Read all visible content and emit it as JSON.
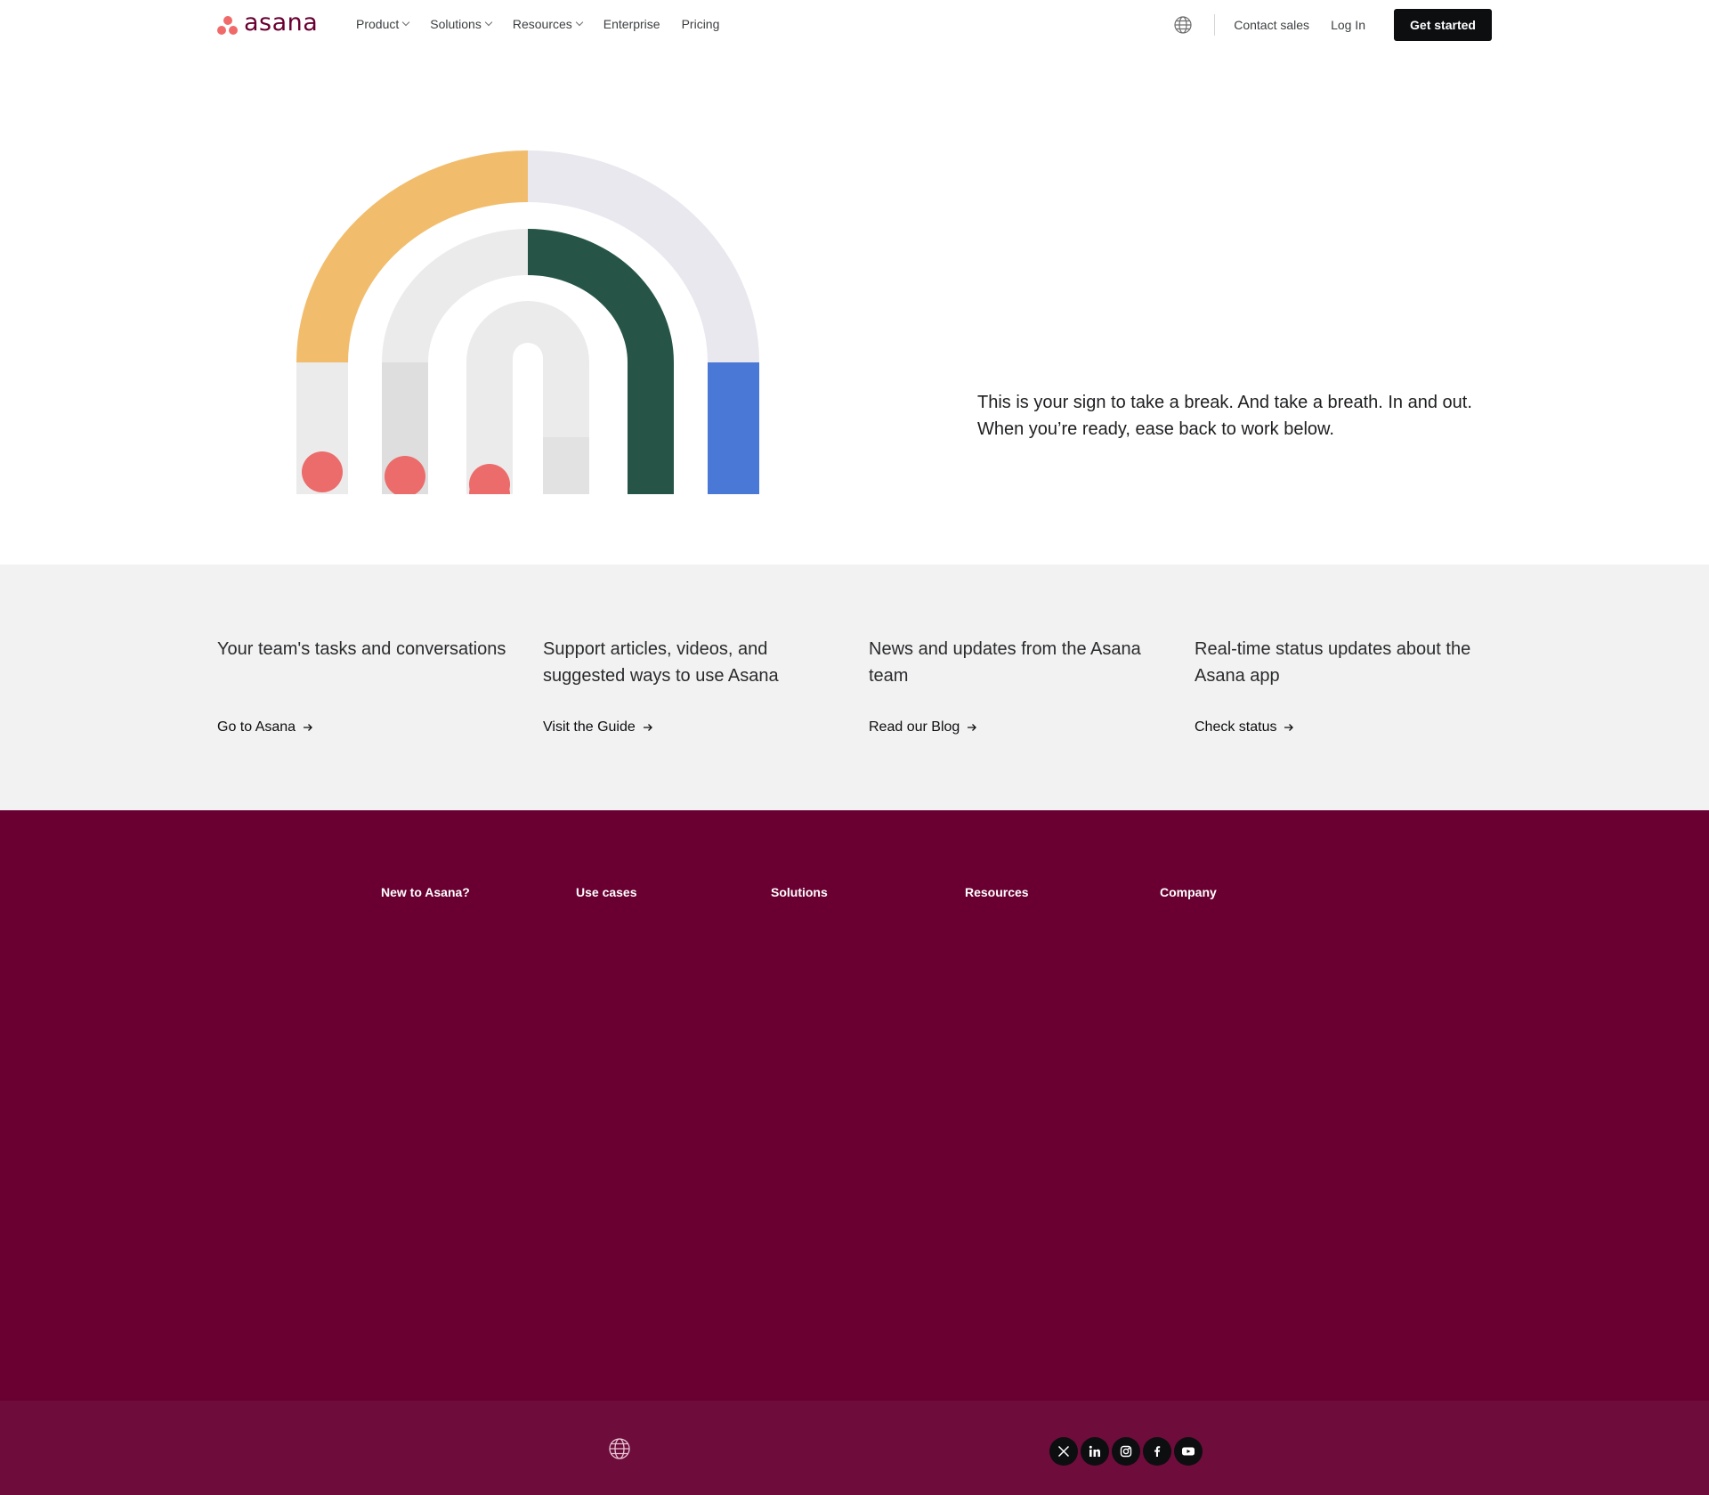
{
  "header": {
    "logo_text": "asana",
    "nav": [
      {
        "label": "Product",
        "dropdown": true
      },
      {
        "label": "Solutions",
        "dropdown": true
      },
      {
        "label": "Resources",
        "dropdown": true
      },
      {
        "label": "Enterprise",
        "dropdown": false
      },
      {
        "label": "Pricing",
        "dropdown": false
      }
    ],
    "contact_sales": "Contact sales",
    "log_in": "Log In",
    "get_started": "Get started"
  },
  "hero": {
    "message_line1": "This is your sign to take a break. And take a breath. In and out.",
    "message_line2": "When you’re ready, ease back to work below."
  },
  "links": [
    {
      "desc": "Your team's tasks and conversations",
      "link": "Go to Asana"
    },
    {
      "desc": "Support articles, videos, and suggested ways to use Asana",
      "link": "Visit the Guide"
    },
    {
      "desc": "News and updates from the Asana team",
      "link": "Read our Blog"
    },
    {
      "desc": "Real-time status updates about the Asana app",
      "link": "Check status"
    }
  ],
  "footer": {
    "columns": [
      "New to Asana?",
      "Use cases",
      "Solutions",
      "Resources",
      "Company"
    ],
    "socials": [
      "x-icon",
      "linkedin-icon",
      "instagram-icon",
      "facebook-icon",
      "youtube-icon"
    ]
  },
  "colors": {
    "brand_coral": "#f06a6a",
    "brand_plum": "#690031",
    "band_gray": "#f2f2f2",
    "arch_yellow": "#f1bd6c",
    "arch_green": "#265547",
    "arch_blue": "#4a78d6"
  }
}
